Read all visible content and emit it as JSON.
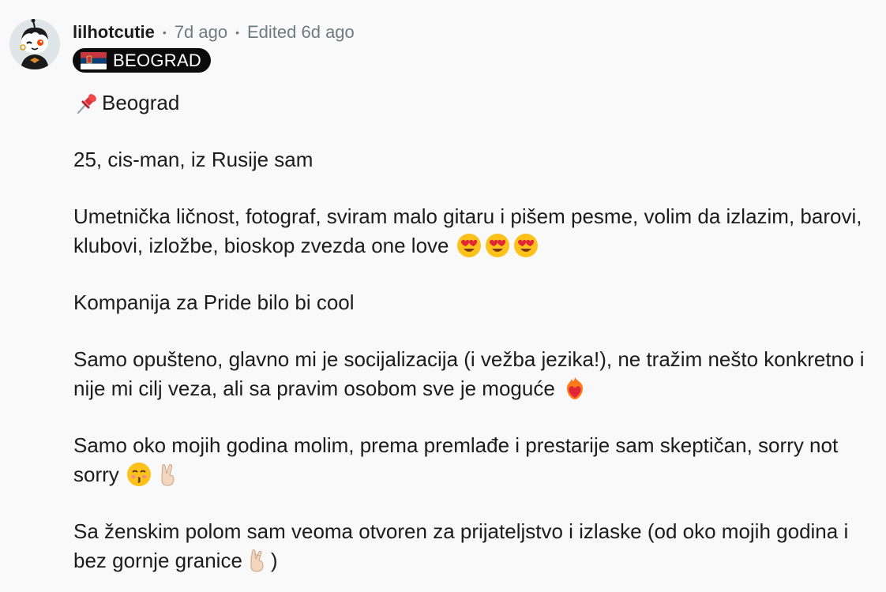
{
  "comment": {
    "username": "lilhotcutie",
    "separator": "•",
    "time": "7d ago",
    "edited": "Edited 6d ago",
    "flair": {
      "flag_icon": "serbia-flag-icon",
      "label": "BEOGRAD"
    },
    "paragraphs": [
      {
        "emoji_before": "pushpin-icon",
        "text": "Beograd"
      },
      {
        "text": "25, cis-man, iz Rusije sam"
      },
      {
        "text": "Umetnička ličnost, fotograf, sviram malo gitaru i pišem pesme, volim da izlazim, barovi, klubovi, izložbe, bioskop zvezda one love",
        "emoji_after": [
          "heart-eyes-emoji",
          "heart-eyes-emoji",
          "heart-eyes-emoji"
        ]
      },
      {
        "text": "Kompanija za Pride bilo bi cool"
      },
      {
        "text": "Samo opušteno, glavno mi je socijalizacija (i vežba jezika!), ne tražim nešto konkretno i nije mi cilj veza, ali sa pravim osobom sve je moguće",
        "emoji_after": [
          "heart-on-fire-emoji"
        ]
      },
      {
        "text": "Samo oko mojih godina molim, prema premlađe i prestarije sam skeptičan, sorry not sorry",
        "emoji_after": [
          "kissing-face-emoji",
          "victory-hand-emoji"
        ]
      },
      {
        "text_before": "Sa ženskim polom sam veoma otvoren za prijateljstvo i izlaske (od oko mojih godina i bez gornje granice",
        "emoji_mid": "crossed-fingers-emoji",
        "text_after": ")"
      }
    ]
  },
  "colors": {
    "background": "#f9f9f9",
    "text": "#1c1c1c",
    "meta": "#6f7a80",
    "flair_bg": "#0b0b0b",
    "flair_text": "#ffffff"
  }
}
